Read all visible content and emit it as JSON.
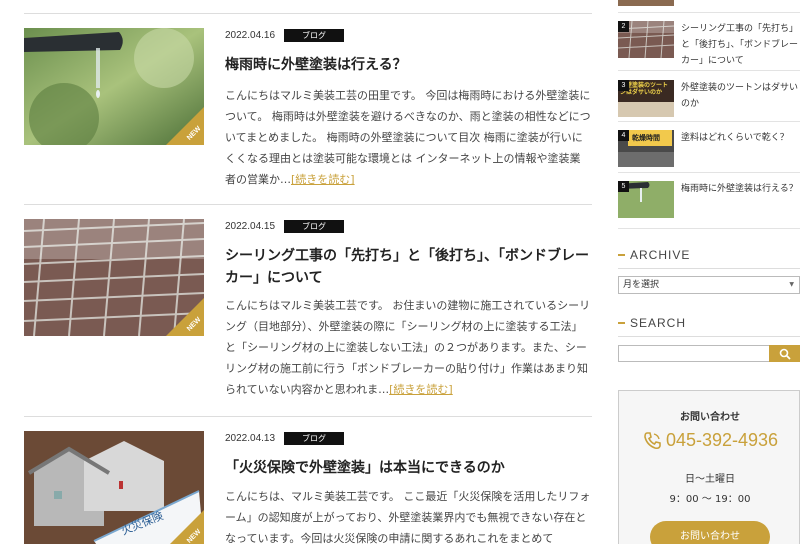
{
  "posts": [
    {
      "date": "2022.04.16",
      "category": "ブログ",
      "title": "梅雨時に外壁塗装は行える？",
      "excerpt": "こんにちはマルミ美装工芸の田里です。 今回は梅雨時における外壁塗装について。 梅雨時は外壁塗装を避けるべきなのか、雨と塗装の相性などについてまとめました。 梅雨時の外壁塗装について目次 梅雨に塗装が行いにくくなる理由とは塗装可能な環境とは インターネット上の情報や塗装業者の営業か…",
      "more": "[続きを読む]",
      "badge": "NEW"
    },
    {
      "date": "2022.04.15",
      "category": "ブログ",
      "title": "シーリング工事の「先打ち」と「後打ち」、「ボンドブレーカー」について",
      "excerpt": "こんにちはマルミ美装工芸です。 お住まいの建物に施工されているシーリング（目地部分）、外壁塗装の際に「シーリング材の上に塗装する工法」と「シーリング材の上に塗装しない工法」の２つがあります。また、シーリング材の施工前に行う「ボンドブレーカーの貼り付け」作業はあまり知られていない内容かと思われま…",
      "more": "[続きを読む]",
      "badge": "NEW"
    },
    {
      "date": "2022.04.13",
      "category": "ブログ",
      "title": "「火災保険で外壁塗装」は本当にできるのか",
      "excerpt": "こんにちは、マルミ美装工芸です。 ここ最近「火災保険を活用したリフォーム」の認知度が上がっており、外壁塗装業界内でも無視できない存在となっています。今回は火災保険の申請に関するあれこれをまとめて",
      "badge": "NEW",
      "thumb_text": "火災保険"
    }
  ],
  "ranking": [
    {
      "num": "2",
      "title": "シーリング工事の「先打ち」と「後打ち」、「ボンドブレーカー」について"
    },
    {
      "num": "3",
      "title": "外壁塗装のツートンはダサいのか",
      "thumb_text": "外壁塗装のツートンはダサいのか"
    },
    {
      "num": "4",
      "title": "塗料はどれくらいで乾く？",
      "thumb_text": "乾燥時間"
    },
    {
      "num": "5",
      "title": "梅雨時に外壁塗装は行える？"
    }
  ],
  "archive": {
    "title": "ARCHIVE",
    "select": "月を選択"
  },
  "search": {
    "title": "SEARCH",
    "placeholder": ""
  },
  "contact": {
    "title": "お問い合わせ",
    "phone": "045-392-4936",
    "days": "日〜土曜日",
    "hours": "9：00 〜 19：00",
    "button": "お問い合わせ"
  },
  "colors": {
    "accent": "#c9a13b",
    "badge": "#111111"
  }
}
